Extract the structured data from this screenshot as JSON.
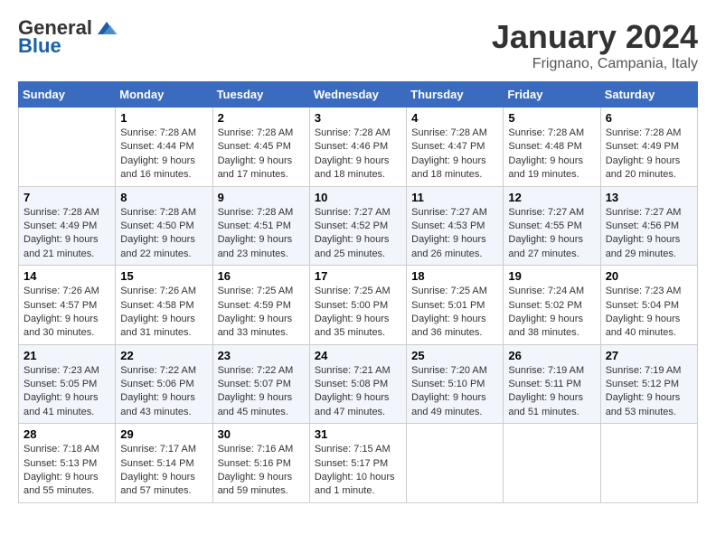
{
  "header": {
    "logo_line1": "General",
    "logo_line2": "Blue",
    "month": "January 2024",
    "location": "Frignano, Campania, Italy"
  },
  "columns": [
    "Sunday",
    "Monday",
    "Tuesday",
    "Wednesday",
    "Thursday",
    "Friday",
    "Saturday"
  ],
  "weeks": [
    [
      {
        "num": "",
        "info": ""
      },
      {
        "num": "1",
        "info": "Sunrise: 7:28 AM\nSunset: 4:44 PM\nDaylight: 9 hours\nand 16 minutes."
      },
      {
        "num": "2",
        "info": "Sunrise: 7:28 AM\nSunset: 4:45 PM\nDaylight: 9 hours\nand 17 minutes."
      },
      {
        "num": "3",
        "info": "Sunrise: 7:28 AM\nSunset: 4:46 PM\nDaylight: 9 hours\nand 18 minutes."
      },
      {
        "num": "4",
        "info": "Sunrise: 7:28 AM\nSunset: 4:47 PM\nDaylight: 9 hours\nand 18 minutes."
      },
      {
        "num": "5",
        "info": "Sunrise: 7:28 AM\nSunset: 4:48 PM\nDaylight: 9 hours\nand 19 minutes."
      },
      {
        "num": "6",
        "info": "Sunrise: 7:28 AM\nSunset: 4:49 PM\nDaylight: 9 hours\nand 20 minutes."
      }
    ],
    [
      {
        "num": "7",
        "info": "Sunrise: 7:28 AM\nSunset: 4:49 PM\nDaylight: 9 hours\nand 21 minutes."
      },
      {
        "num": "8",
        "info": "Sunrise: 7:28 AM\nSunset: 4:50 PM\nDaylight: 9 hours\nand 22 minutes."
      },
      {
        "num": "9",
        "info": "Sunrise: 7:28 AM\nSunset: 4:51 PM\nDaylight: 9 hours\nand 23 minutes."
      },
      {
        "num": "10",
        "info": "Sunrise: 7:27 AM\nSunset: 4:52 PM\nDaylight: 9 hours\nand 25 minutes."
      },
      {
        "num": "11",
        "info": "Sunrise: 7:27 AM\nSunset: 4:53 PM\nDaylight: 9 hours\nand 26 minutes."
      },
      {
        "num": "12",
        "info": "Sunrise: 7:27 AM\nSunset: 4:55 PM\nDaylight: 9 hours\nand 27 minutes."
      },
      {
        "num": "13",
        "info": "Sunrise: 7:27 AM\nSunset: 4:56 PM\nDaylight: 9 hours\nand 29 minutes."
      }
    ],
    [
      {
        "num": "14",
        "info": "Sunrise: 7:26 AM\nSunset: 4:57 PM\nDaylight: 9 hours\nand 30 minutes."
      },
      {
        "num": "15",
        "info": "Sunrise: 7:26 AM\nSunset: 4:58 PM\nDaylight: 9 hours\nand 31 minutes."
      },
      {
        "num": "16",
        "info": "Sunrise: 7:25 AM\nSunset: 4:59 PM\nDaylight: 9 hours\nand 33 minutes."
      },
      {
        "num": "17",
        "info": "Sunrise: 7:25 AM\nSunset: 5:00 PM\nDaylight: 9 hours\nand 35 minutes."
      },
      {
        "num": "18",
        "info": "Sunrise: 7:25 AM\nSunset: 5:01 PM\nDaylight: 9 hours\nand 36 minutes."
      },
      {
        "num": "19",
        "info": "Sunrise: 7:24 AM\nSunset: 5:02 PM\nDaylight: 9 hours\nand 38 minutes."
      },
      {
        "num": "20",
        "info": "Sunrise: 7:23 AM\nSunset: 5:04 PM\nDaylight: 9 hours\nand 40 minutes."
      }
    ],
    [
      {
        "num": "21",
        "info": "Sunrise: 7:23 AM\nSunset: 5:05 PM\nDaylight: 9 hours\nand 41 minutes."
      },
      {
        "num": "22",
        "info": "Sunrise: 7:22 AM\nSunset: 5:06 PM\nDaylight: 9 hours\nand 43 minutes."
      },
      {
        "num": "23",
        "info": "Sunrise: 7:22 AM\nSunset: 5:07 PM\nDaylight: 9 hours\nand 45 minutes."
      },
      {
        "num": "24",
        "info": "Sunrise: 7:21 AM\nSunset: 5:08 PM\nDaylight: 9 hours\nand 47 minutes."
      },
      {
        "num": "25",
        "info": "Sunrise: 7:20 AM\nSunset: 5:10 PM\nDaylight: 9 hours\nand 49 minutes."
      },
      {
        "num": "26",
        "info": "Sunrise: 7:19 AM\nSunset: 5:11 PM\nDaylight: 9 hours\nand 51 minutes."
      },
      {
        "num": "27",
        "info": "Sunrise: 7:19 AM\nSunset: 5:12 PM\nDaylight: 9 hours\nand 53 minutes."
      }
    ],
    [
      {
        "num": "28",
        "info": "Sunrise: 7:18 AM\nSunset: 5:13 PM\nDaylight: 9 hours\nand 55 minutes."
      },
      {
        "num": "29",
        "info": "Sunrise: 7:17 AM\nSunset: 5:14 PM\nDaylight: 9 hours\nand 57 minutes."
      },
      {
        "num": "30",
        "info": "Sunrise: 7:16 AM\nSunset: 5:16 PM\nDaylight: 9 hours\nand 59 minutes."
      },
      {
        "num": "31",
        "info": "Sunrise: 7:15 AM\nSunset: 5:17 PM\nDaylight: 10 hours\nand 1 minute."
      },
      {
        "num": "",
        "info": ""
      },
      {
        "num": "",
        "info": ""
      },
      {
        "num": "",
        "info": ""
      }
    ]
  ]
}
